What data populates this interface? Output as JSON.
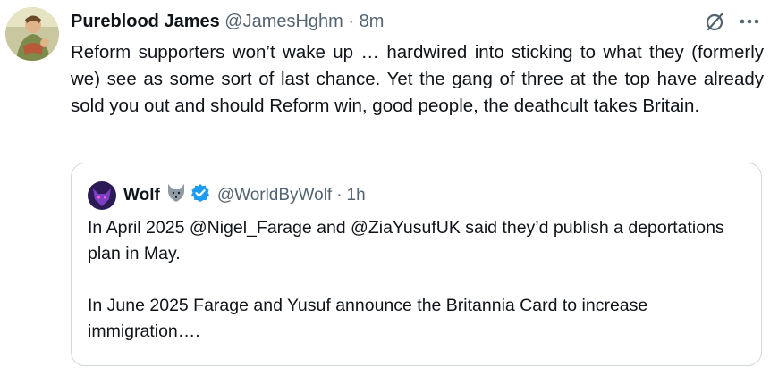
{
  "tweet": {
    "author_name": "Pureblood James",
    "author_handle": "@JamesHghm",
    "separator": "·",
    "time": "8m",
    "text": "Reform supporters won’t wake up … hardwired into sticking to what they (formerly we) see as some sort of last chance. Yet the gang of three at the top have already sold you out and should Reform win, good people, the deathcult takes Britain."
  },
  "quote": {
    "author_name": "Wolf",
    "author_handle": "@WorldByWolf",
    "separator": "·",
    "time": "1h",
    "paragraphs": [
      "In April 2025 @Nigel_Farage and @ZiaYusufUK said they’d publish a deportations plan in May.",
      "In June 2025 Farage and Yusuf announce the Britannia Card to increase immigration…."
    ]
  },
  "icons": {
    "grok": "grok-icon",
    "more": "more-icon",
    "wolf": "wolf-emoji-icon",
    "verified": "verified-badge-icon"
  },
  "colors": {
    "text": "#0f1419",
    "secondary": "#536471",
    "border": "#cfd9de",
    "verified": "#1d9bf0"
  }
}
